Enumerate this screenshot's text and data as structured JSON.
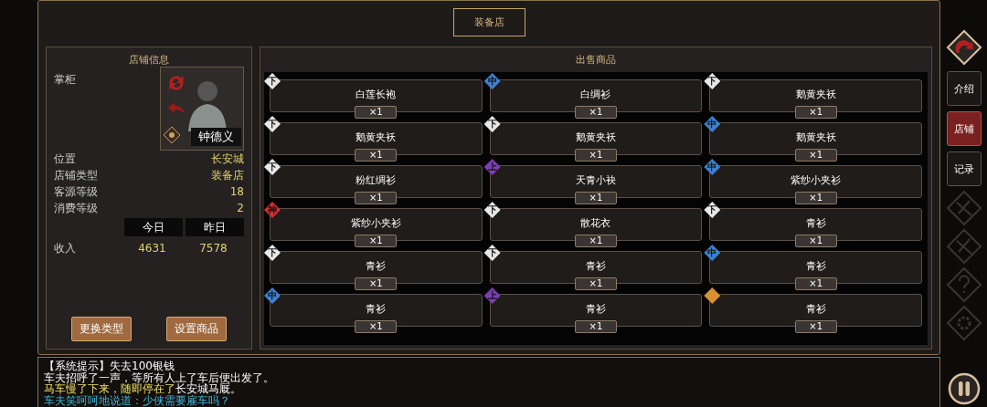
{
  "title": "装备店",
  "shop_info": {
    "heading": "店铺信息",
    "keeper_label": "掌柜",
    "keeper_name": "钟德义",
    "fields": [
      {
        "label": "位置",
        "value": "长安城"
      },
      {
        "label": "店铺类型",
        "value": "装备店"
      },
      {
        "label": "客源等级",
        "value": "18"
      },
      {
        "label": "消费等级",
        "value": "2"
      }
    ],
    "income": {
      "columns": [
        "今日",
        "昨日"
      ],
      "label": "收入",
      "values": [
        "4631",
        "7578"
      ]
    },
    "buttons": [
      "更换类型",
      "设置商品"
    ]
  },
  "goods": {
    "heading": "出售商品",
    "items": [
      {
        "name": "白莲长袍",
        "qty": "×1",
        "grade": "下",
        "color": "#e8e8e8"
      },
      {
        "name": "白绸衫",
        "qty": "×1",
        "grade": "中",
        "color": "#3f7fd0"
      },
      {
        "name": "鹅黄夹袄",
        "qty": "×1",
        "grade": "下",
        "color": "#e8e8e8"
      },
      {
        "name": "鹅黄夹袄",
        "qty": "×1",
        "grade": "下",
        "color": "#e8e8e8"
      },
      {
        "name": "鹅黄夹袄",
        "qty": "×1",
        "grade": "下",
        "color": "#e8e8e8"
      },
      {
        "name": "鹅黄夹袄",
        "qty": "×1",
        "grade": "中",
        "color": "#3f7fd0"
      },
      {
        "name": "粉红绸衫",
        "qty": "×1",
        "grade": "下",
        "color": "#e8e8e8"
      },
      {
        "name": "天青小袂",
        "qty": "×1",
        "grade": "上",
        "color": "#7a3fb0"
      },
      {
        "name": "紫纱小夹衫",
        "qty": "×1",
        "grade": "中",
        "color": "#3f7fd0"
      },
      {
        "name": "紫纱小夹衫",
        "qty": "×1",
        "grade": "神",
        "color": "#d03030"
      },
      {
        "name": "散花衣",
        "qty": "×1",
        "grade": "下",
        "color": "#e8e8e8"
      },
      {
        "name": "青衫",
        "qty": "×1",
        "grade": "下",
        "color": "#e8e8e8"
      },
      {
        "name": "青衫",
        "qty": "×1",
        "grade": "下",
        "color": "#e8e8e8"
      },
      {
        "name": "青衫",
        "qty": "×1",
        "grade": "下",
        "color": "#e8e8e8"
      },
      {
        "name": "青衫",
        "qty": "×1",
        "grade": "中",
        "color": "#3f7fd0"
      },
      {
        "name": "青衫",
        "qty": "×1",
        "grade": "中",
        "color": "#3f7fd0"
      },
      {
        "name": "青衫",
        "qty": "×1",
        "grade": "上",
        "color": "#7a3fb0"
      },
      {
        "name": "青衫",
        "qty": "×1",
        "color": "#d89030"
      }
    ]
  },
  "side_tabs": [
    {
      "label": "介绍",
      "selected": false
    },
    {
      "label": "店铺",
      "selected": true
    },
    {
      "label": "记录",
      "selected": false
    }
  ],
  "log": [
    {
      "kind": "system",
      "text": "【系统提示】失去100银钱"
    },
    {
      "kind": "plain",
      "text": "车夫招呼了一声，等所有人上了车后便出发了。"
    },
    {
      "kind": "event",
      "text": "马车慢了下来，随即停在了",
      "tail": "长安城马厩。"
    },
    {
      "kind": "speech",
      "text": "车夫笑呵呵地说道：少侠需要雇车吗？"
    }
  ]
}
